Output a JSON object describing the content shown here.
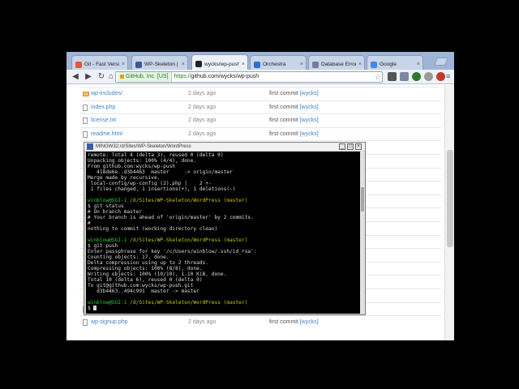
{
  "browser": {
    "tabs": [
      {
        "title": "Git - Fast Version",
        "favicon_color": "#f05033"
      },
      {
        "title": "WP-Skeleton | Ju...",
        "favicon_color": "#3b5998"
      },
      {
        "title": "wycks/wp-push",
        "favicon_color": "#222222"
      },
      {
        "title": "Orchestra",
        "favicon_color": "#2a6fd4"
      },
      {
        "title": "Database Error",
        "favicon_color": "#7a7a9a"
      },
      {
        "title": "Google",
        "favicon_color": "#4285f4"
      }
    ],
    "ev_label": "GitHub, Inc. [US]",
    "url_scheme": "https://",
    "url_rest": "github.com/wycks/wp-push"
  },
  "files": [
    {
      "name": "wp-includes/",
      "age": "2 days ago",
      "msg": "first commit",
      "author": "[wycks]",
      "folder": true
    },
    {
      "name": "index.php",
      "age": "2 days ago",
      "msg": "first commit",
      "author": "[wycks]",
      "folder": false
    },
    {
      "name": "license.txt",
      "age": "2 days ago",
      "msg": "first commit",
      "author": "[wycks]",
      "folder": false
    },
    {
      "name": "readme.html",
      "age": "2 days ago",
      "msg": "first commit",
      "author": "[wycks]",
      "folder": false
    },
    {
      "name": "",
      "age": "",
      "msg": "",
      "author": "",
      "folder": false
    },
    {
      "name": "",
      "age": "",
      "msg": "",
      "author": "",
      "folder": false
    },
    {
      "name": "",
      "age": "",
      "msg": "",
      "author": "",
      "folder": false
    },
    {
      "name": "",
      "age": "",
      "msg": "",
      "author": "",
      "folder": false
    },
    {
      "name": "",
      "age": "",
      "msg": "",
      "author": "",
      "folder": false
    },
    {
      "name": "",
      "age": "",
      "msg": "",
      "author": "",
      "folder": false
    },
    {
      "name": "",
      "age": "",
      "msg": "",
      "author": "",
      "folder": false
    },
    {
      "name": "",
      "age": "",
      "msg": "",
      "author": "",
      "folder": false
    },
    {
      "name": "",
      "age": "",
      "msg": "",
      "author": "",
      "folder": false
    },
    {
      "name": "",
      "age": "",
      "msg": "",
      "author": "",
      "folder": false
    },
    {
      "name": "",
      "age": "",
      "msg": "",
      "author": "",
      "folder": false
    },
    {
      "name": "",
      "age": "",
      "msg": "",
      "author": "",
      "folder": false
    },
    {
      "name": "wp-settings.php",
      "age": "2 days ago",
      "msg": "first commit",
      "author": "[wycks]",
      "folder": false
    },
    {
      "name": "wp-signup.php",
      "age": "2 days ago",
      "msg": "first commit",
      "author": "[wycks]",
      "folder": false
    }
  ],
  "terminal": {
    "title": "MINGW32:/d/Sites/WP-Skeleton/WordPress",
    "lines": [
      {
        "text": "remote: Total 4 (delta 3), reused 0 (delta 0)",
        "kind": "normal"
      },
      {
        "text": "Unpacking objects: 100% (4/4), done.",
        "kind": "normal"
      },
      {
        "text": "From github.com:wycks/wp-push",
        "kind": "normal"
      },
      {
        "text": "   418de6e..d3b4463  master     -> origin/master",
        "kind": "normal"
      },
      {
        "text": "Merge made by recursive.",
        "kind": "normal"
      },
      {
        "text": " local-config/wp-config (2).php |    2 +-",
        "kind": "normal"
      },
      {
        "text": " 1 files changed, 1 insertions(+), 1 deletions(-)",
        "kind": "normal"
      },
      {
        "text": "",
        "kind": "normal"
      },
      {
        "user": "winblow@SGI-1",
        "path": " /d/Sites/WP-Skeleton/WordPress (master)",
        "kind": "prompt"
      },
      {
        "text": "$ git status",
        "kind": "normal"
      },
      {
        "text": "# On branch master",
        "kind": "normal"
      },
      {
        "text": "# Your branch is ahead of 'origin/master' by 2 commits.",
        "kind": "normal"
      },
      {
        "text": "#",
        "kind": "normal"
      },
      {
        "text": "nothing to commit (working directory clean)",
        "kind": "normal"
      },
      {
        "text": "",
        "kind": "normal"
      },
      {
        "user": "winblow@SGI-1",
        "path": " /d/Sites/WP-Skeleton/WordPress (master)",
        "kind": "prompt"
      },
      {
        "text": "$ git push",
        "kind": "normal"
      },
      {
        "text": "Enter passphrase for key '/c/Users/winblow/.ssh/id_rsa':",
        "kind": "normal"
      },
      {
        "text": "Counting objects: 17, done.",
        "kind": "normal"
      },
      {
        "text": "Delta compression using up to 2 threads.",
        "kind": "normal"
      },
      {
        "text": "Compressing objects: 100% (8/8), done.",
        "kind": "normal"
      },
      {
        "text": "Writing objects: 100% (10/10), 1.10 KiB, done.",
        "kind": "normal"
      },
      {
        "text": "Total 10 (delta 6), reused 0 (delta 0)",
        "kind": "normal"
      },
      {
        "text": "To git@github.com:wycks/wp-push.git",
        "kind": "normal"
      },
      {
        "text": "   d3b4463..494c991  master -> master",
        "kind": "normal"
      },
      {
        "text": "",
        "kind": "normal"
      },
      {
        "user": "winblow@SGI-1",
        "path": " /d/Sites/WP-Skeleton/WordPress (master)",
        "kind": "prompt"
      },
      {
        "text": "$ ",
        "kind": "cursor"
      }
    ]
  },
  "colors": {
    "link": "#4183c4",
    "terminal_prompt": "#2ecc40",
    "terminal_path": "#c8c800"
  }
}
